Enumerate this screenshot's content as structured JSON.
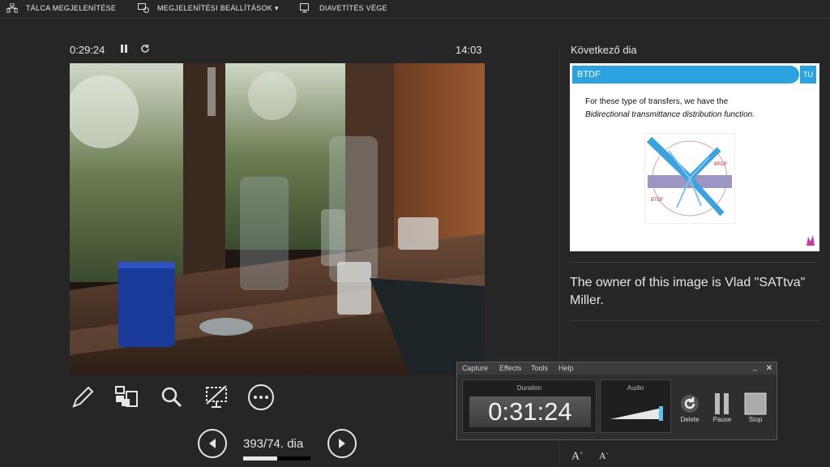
{
  "toolbar": {
    "taskbar_label": "TÁLCA MEGJELENÍTÉSE",
    "display_settings_label": "MEGJELENÍTÉSI BEÁLLÍTÁSOK ▾",
    "end_show_label": "DIAVETÍTÉS VÉGE"
  },
  "timer": {
    "elapsed": "0:29:24",
    "clock": "14:03"
  },
  "navigation": {
    "counter": "393/74. dia",
    "progress": 0.5
  },
  "next_slide": {
    "label": "Következő dia",
    "title": "BTDF",
    "body_line1": "For  these  type  of  transfers,  we  have  the",
    "body_line2": "Bidirectional transmittance distribution function.",
    "badge": "TU",
    "diagram_label1": "BRDF",
    "diagram_label2": "BTDF"
  },
  "notes": {
    "text": "The owner of this image is Vlad \"SATtva\" Miller."
  },
  "capture_panel": {
    "menu": [
      "Capture",
      "Effects",
      "Tools",
      "Help"
    ],
    "duration_label": "Duration",
    "duration_value": "0:31:24",
    "audio_label": "Audio",
    "delete_label": "Delete",
    "pause_label": "Pause",
    "stop_label": "Stop"
  },
  "font_buttons": {
    "increase": "A",
    "decrease": "A"
  },
  "colors": {
    "background": "#262626",
    "accent_blue": "#2aa3e0"
  }
}
